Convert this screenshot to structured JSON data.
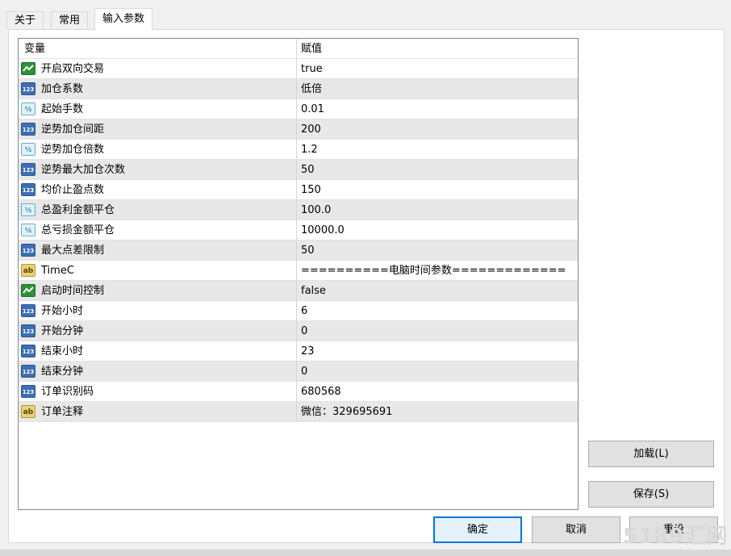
{
  "tabs": [
    {
      "label": "关于"
    },
    {
      "label": "常用"
    },
    {
      "label": "输入参数"
    }
  ],
  "grid": {
    "headers": {
      "variable": "变量",
      "value": "赋值"
    },
    "rows": [
      {
        "name": "开启双向交易",
        "value": "true",
        "type": "bool-icon"
      },
      {
        "name": "加仓系数",
        "value": "低倍",
        "type": "int-icon"
      },
      {
        "name": "起始手数",
        "value": "0.01",
        "type": "double-icon"
      },
      {
        "name": "逆势加仓间距",
        "value": "200",
        "type": "int-icon"
      },
      {
        "name": "逆势加仓倍数",
        "value": "1.2",
        "type": "double-icon"
      },
      {
        "name": "逆势最大加仓次数",
        "value": "50",
        "type": "int-icon"
      },
      {
        "name": "均价止盈点数",
        "value": "150",
        "type": "int-icon"
      },
      {
        "name": "总盈利金额平仓",
        "value": "100.0",
        "type": "double-icon"
      },
      {
        "name": "总亏损金额平仓",
        "value": "10000.0",
        "type": "double-icon"
      },
      {
        "name": "最大点差限制",
        "value": "50",
        "type": "int-icon"
      },
      {
        "name": "TimeC",
        "value": "==========电脑时间参数=============",
        "type": "string-icon"
      },
      {
        "name": "启动时间控制",
        "value": "false",
        "type": "bool-icon"
      },
      {
        "name": "开始小时",
        "value": "6",
        "type": "int-icon"
      },
      {
        "name": "开始分钟",
        "value": "0",
        "type": "int-icon"
      },
      {
        "name": "结束小时",
        "value": "23",
        "type": "int-icon"
      },
      {
        "name": "结束分钟",
        "value": "0",
        "type": "int-icon"
      },
      {
        "name": "订单识别码",
        "value": "680568",
        "type": "int-icon"
      },
      {
        "name": "订单注释",
        "value": "微信：329695691",
        "type": "string-icon"
      }
    ]
  },
  "icon_text": {
    "int": "123",
    "double": "½",
    "string": "ab"
  },
  "buttons": {
    "load": "加载(L)",
    "save": "保存(S)",
    "ok": "确定",
    "cancel": "取消",
    "reset": "重设"
  },
  "watermark": "5189汇网",
  "colors": {
    "alt_row": "#e8e8e8",
    "primary_border": "#0078d7",
    "bool_icon": "#2f8f3a",
    "int_icon": "#3c6fb3"
  }
}
